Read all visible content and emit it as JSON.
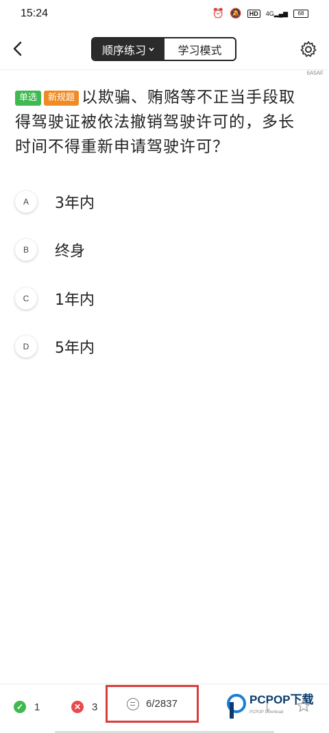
{
  "status_bar": {
    "time": "15:24",
    "hd": "HD",
    "signal": "4G",
    "battery": "68"
  },
  "nav": {
    "mode_active": "顺序练习",
    "mode_other": "学习模式"
  },
  "question_code": "6A5AF",
  "question": {
    "tags": [
      "单选",
      "新规题"
    ],
    "text": "以欺骗、贿赂等不正当手段取得驾驶证被依法撤销驾驶许可的，多长时间不得重新申请驾驶许可？"
  },
  "options": [
    {
      "letter": "A",
      "text": "3年内"
    },
    {
      "letter": "B",
      "text": "终身"
    },
    {
      "letter": "C",
      "text": "1年内"
    },
    {
      "letter": "D",
      "text": "5年内"
    }
  ],
  "bottom": {
    "correct_count": "1",
    "wrong_count": "3",
    "progress": "6/2837",
    "watermark_brand": "PCPOP下载",
    "watermark_sub": "PCPOP Download"
  },
  "colors": {
    "green": "#3fb950",
    "orange": "#f08a24",
    "red": "#e8494d",
    "highlight_box": "#d93b3b"
  }
}
